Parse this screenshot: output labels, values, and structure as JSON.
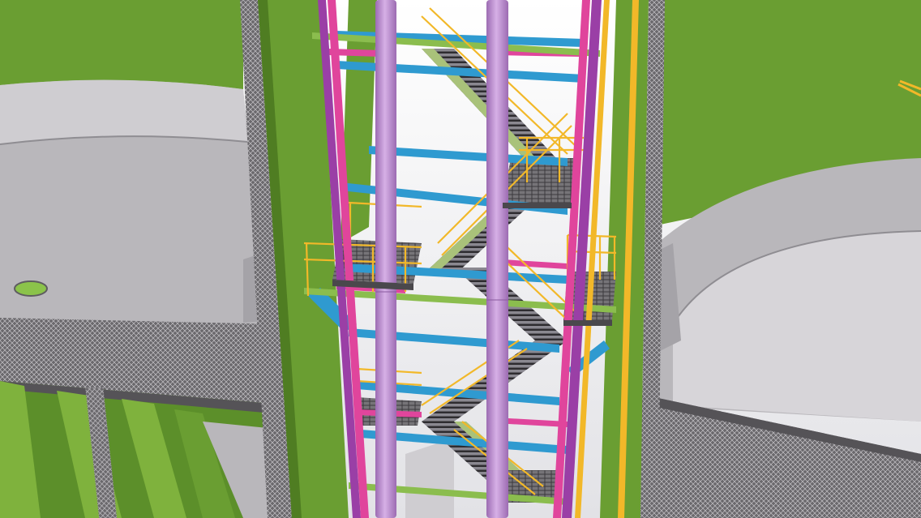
{
  "scene": {
    "subject": "",
    "colors": {
      "background": "#ffffff",
      "green_structure": "#6a9e32",
      "green_dark": "#4f7d22",
      "green_light": "#7fb23d",
      "concrete": "#b9b7bb",
      "concrete_dark": "#8f8d92",
      "grating": "#5e5c60",
      "column_magenta": "#9a3fa6",
      "column_pink": "#e0459c",
      "beam_blue": "#2f9ad0",
      "beam_blue_dark": "#1f6f9f",
      "pipe_violet": "#c79ad8",
      "pipe_violet_dark": "#9c6bb2",
      "handrail_yellow": "#f2b829",
      "stair_green": "#a9c27a",
      "stair_dark": "#55504c"
    }
  }
}
